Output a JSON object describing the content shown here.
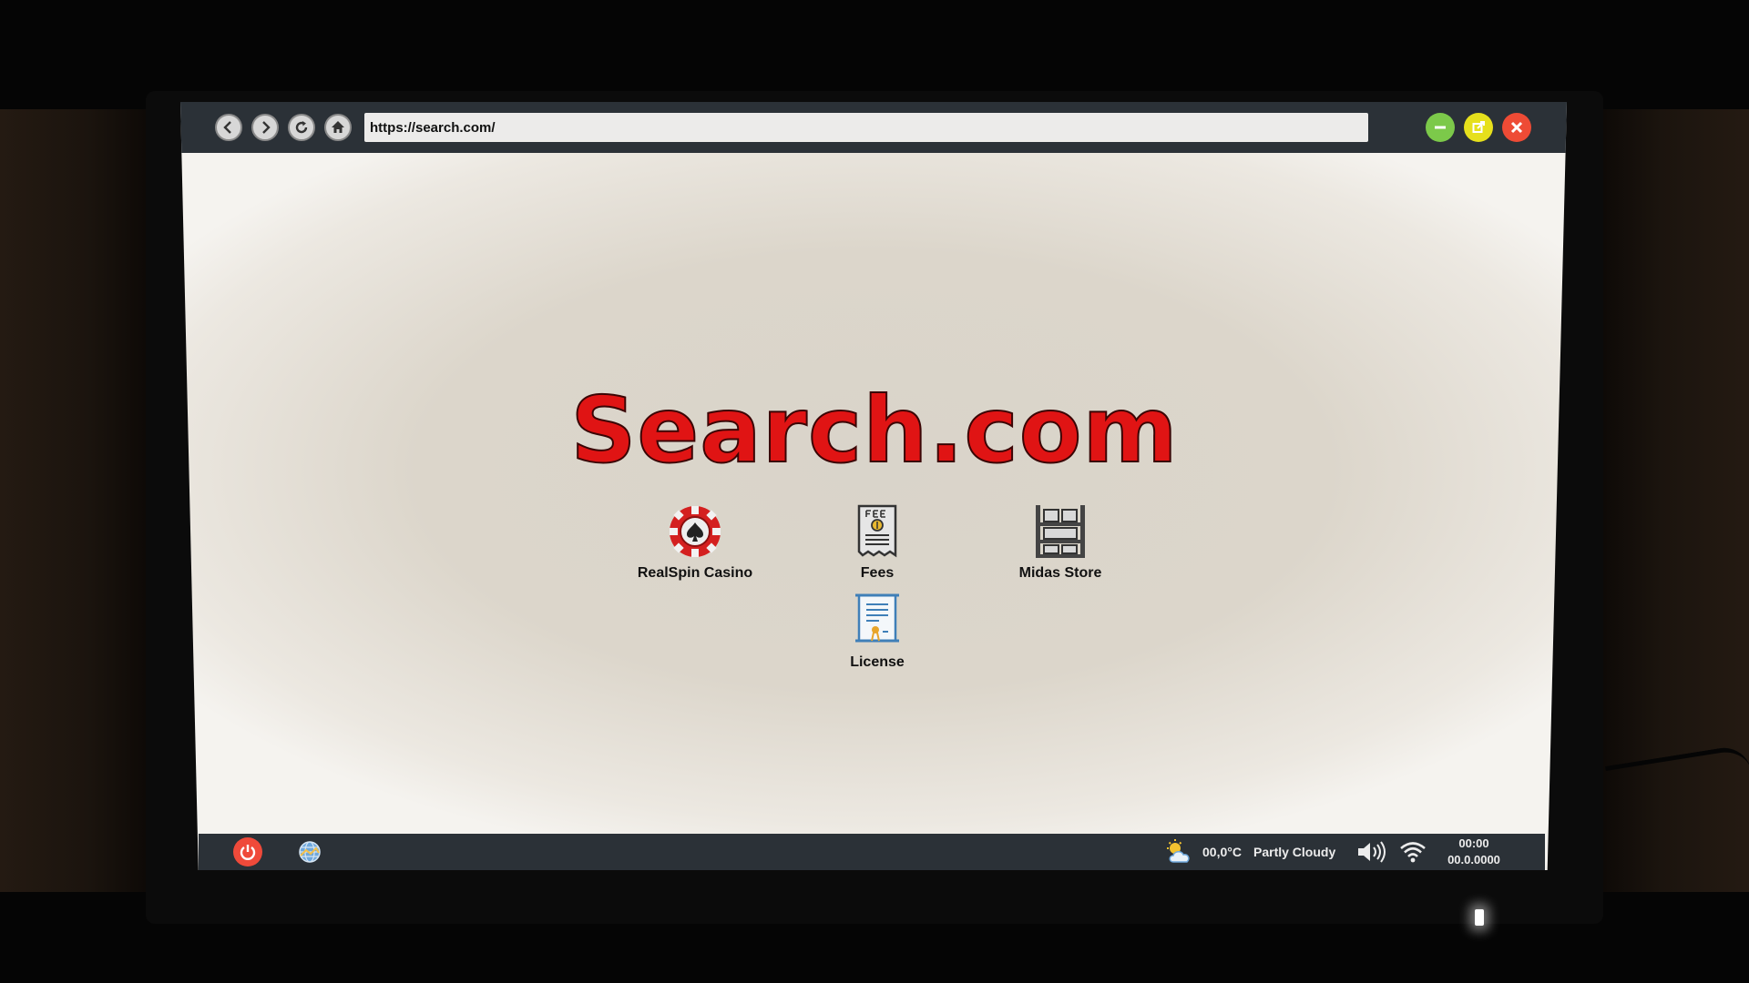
{
  "browser": {
    "url": "https://search.com/"
  },
  "page": {
    "logo_text": "Search.com"
  },
  "shortcuts": [
    {
      "label": "RealSpin Casino",
      "icon": "casino-chip-icon"
    },
    {
      "label": "Fees",
      "icon": "fee-receipt-icon"
    },
    {
      "label": "Midas Store",
      "icon": "shelves-icon"
    },
    {
      "label": "License",
      "icon": "license-certificate-icon"
    }
  ],
  "taskbar": {
    "temperature": "00,0°C",
    "weather": "Partly Cloudy",
    "time": "00:00",
    "date": "00.0.0000"
  },
  "colors": {
    "accent_red": "#e01414",
    "minimize": "#7cc94a",
    "maximize": "#e6e01c",
    "close": "#ee4b35",
    "bar": "#2b3137"
  }
}
